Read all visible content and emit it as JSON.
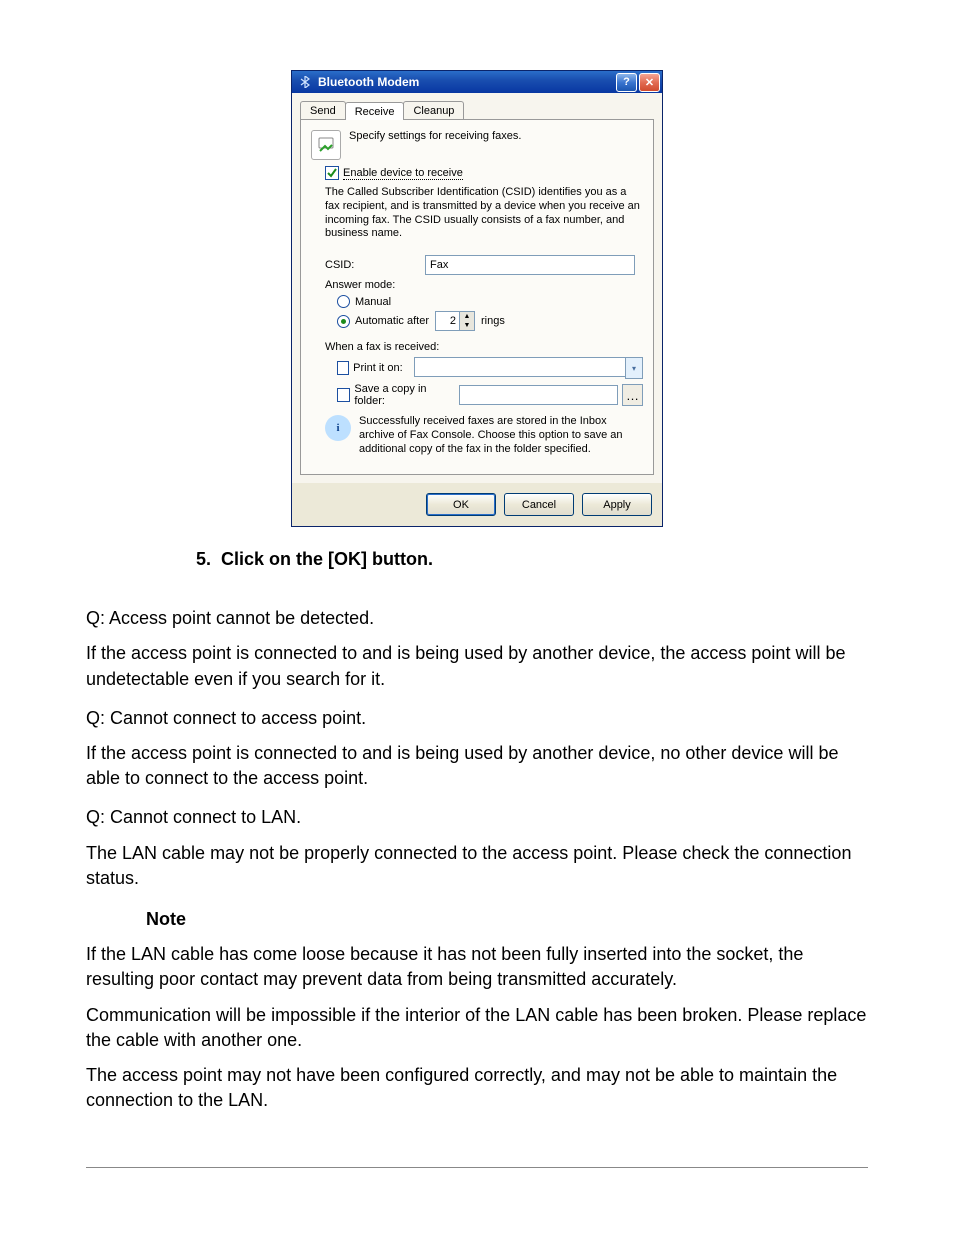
{
  "dialog": {
    "title": "Bluetooth Modem",
    "help_button": "?",
    "close_button": "✕",
    "tabs": {
      "send": "Send",
      "receive": "Receive",
      "cleanup": "Cleanup"
    },
    "intro": "Specify settings for receiving faxes.",
    "enable_checkbox": "Enable device to receive",
    "csid_help": "The Called Subscriber Identification (CSID) identifies you as a fax recipient, and is transmitted by a device when you receive an incoming fax. The CSID usually consists of a fax number, and business name.",
    "csid_label": "CSID:",
    "csid_value": "Fax",
    "answer_mode_label": "Answer mode:",
    "manual_label": "Manual",
    "automatic_label": "Automatic after",
    "rings_value": "2",
    "rings_unit": "rings",
    "when_received_label": "When a fax is received:",
    "print_label": "Print it on:",
    "save_copy_label": "Save a copy in folder:",
    "info_text": "Successfully received faxes are stored in the Inbox archive of Fax Console. Choose this option to save an additional copy of the fax in the folder specified.",
    "ok": "OK",
    "cancel": "Cancel",
    "apply": "Apply"
  },
  "instruction": {
    "number": "5.",
    "text": "Click on the [OK] button."
  },
  "q1": {
    "q": "Q: Access point cannot be detected.",
    "a": "If the access point is connected to and is being used by another device, the access point will be undetectable even if you search for it."
  },
  "q2": {
    "q": "Q: Cannot connect to access point.",
    "a": "If the access point is connected to and is being used by another device, no other device will be able to connect to the access point."
  },
  "q3": {
    "q": "Q: Cannot connect to LAN.",
    "a1": "The LAN cable may not be properly connected to the access point. Please check the connection status.",
    "note_heading": "Note",
    "note1": "If the LAN cable has come loose because it has not been fully inserted into the socket, the resulting poor contact may prevent data from being transmitted accurately.",
    "note2": "Communication will be impossible if the interior of the LAN cable has been broken. Please replace the cable with another one.",
    "a2": "The access point may not have been configured correctly, and may not be able to maintain the connection to the LAN."
  }
}
